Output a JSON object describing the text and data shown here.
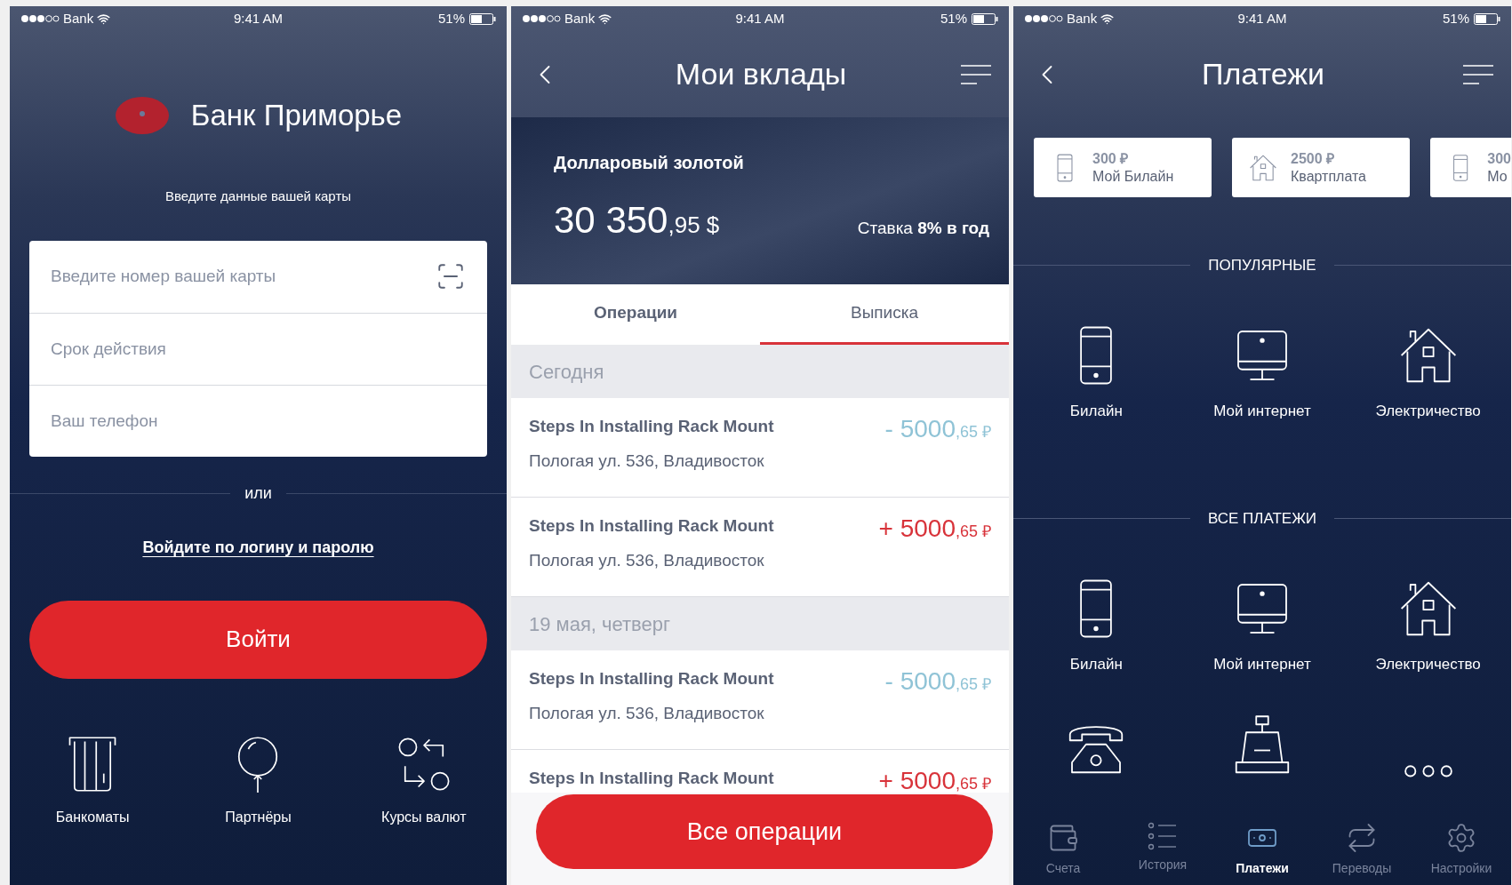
{
  "login_screen": {
    "status_bar": {
      "carrier": "Bank",
      "time": "9:41 AM",
      "battery": "51%"
    },
    "bank_name": "Банк Приморье",
    "prompt": "Введите данные вашей карты",
    "fields": [
      {
        "placeholder": "Введите номер вашей карты",
        "scan": true
      },
      {
        "placeholder": "Срок действия",
        "scan": false
      },
      {
        "placeholder": "Ваш телефон",
        "scan": false
      }
    ],
    "divider_label": "или",
    "login_link": "Войдите по логину и паролю",
    "submit_button": "Войти",
    "shortcuts": [
      {
        "kind": "atm",
        "label": "Банкоматы"
      },
      {
        "kind": "balloon",
        "label": "Партнёры"
      },
      {
        "kind": "exchange",
        "label": "Курсы валют"
      }
    ]
  },
  "deposits_screen": {
    "status_bar": {
      "carrier": "Bank",
      "time": "9:41 AM",
      "battery": "51%"
    },
    "title": "Мои вклады",
    "deposit": {
      "name": "Долларовый золотой",
      "amount": "30 350",
      "fraction": ",95 $",
      "rate": "Ставка **8% в год**"
    },
    "tabs": [
      {
        "label": "Операции",
        "selected": false
      },
      {
        "label": "Выписка",
        "selected": true
      }
    ],
    "groups": [
      {
        "date": "Сегодня",
        "transactions": [
          {
            "title": "Steps In Installing Rack Mount",
            "address": "Пологая ул. 536, Владивосток",
            "kind": "debit",
            "amount": "- 5000",
            "fraction": ",65 ₽"
          },
          {
            "title": "Steps In Installing Rack Mount",
            "address": "Пологая ул. 536, Владивосток",
            "kind": "credit",
            "amount": "+ 5000",
            "fraction": ",65 ₽"
          }
        ]
      },
      {
        "date": "19 мая, четверг",
        "transactions": [
          {
            "title": "Steps In Installing Rack Mount",
            "address": "Пологая ул. 536, Владивосток",
            "kind": "debit",
            "amount": "- 5000",
            "fraction": ",65 ₽"
          },
          {
            "title": "Steps In Installing Rack Mount",
            "kind": "credit",
            "amount": "+ 5000",
            "fraction": ",65 ₽"
          }
        ]
      }
    ],
    "action_button": "Все операции"
  },
  "payments_screen": {
    "status_bar": {
      "carrier": "Bank",
      "time": "9:41 AM",
      "battery": "51%"
    },
    "title": "Платежи",
    "recent": [
      {
        "kind": "phone",
        "amount": "300 ₽",
        "name": "Мой Билайн"
      },
      {
        "kind": "house",
        "amount": "2500 ₽",
        "name": "Квартплата"
      },
      {
        "kind": "phone",
        "amount": "300",
        "name": "Мо"
      }
    ],
    "sections": [
      {
        "heading": "ПОПУЛЯРНЫЕ",
        "items": [
          {
            "kind": "phone",
            "label": "Билайн"
          },
          {
            "kind": "monitor",
            "label": "Мой интернет"
          },
          {
            "kind": "house",
            "label": "Электричество"
          }
        ]
      },
      {
        "heading": "ВСЕ ПЛАТЕЖИ",
        "items": [
          {
            "kind": "phone",
            "label": "Билайн"
          },
          {
            "kind": "monitor",
            "label": "Мой интернет"
          },
          {
            "kind": "house",
            "label": "Электричество"
          },
          {
            "kind": "telephone"
          },
          {
            "kind": "register"
          },
          {
            "kind": "more"
          }
        ]
      }
    ],
    "tab_bar": [
      {
        "kind": "wallet",
        "label": "Счета",
        "selected": false
      },
      {
        "kind": "list",
        "label": "История",
        "selected": false
      },
      {
        "kind": "cash",
        "label": "Платежи",
        "selected": true
      },
      {
        "kind": "transfer",
        "label": "Переводы",
        "selected": false
      },
      {
        "kind": "settings",
        "label": "Настройки",
        "selected": false
      }
    ]
  }
}
